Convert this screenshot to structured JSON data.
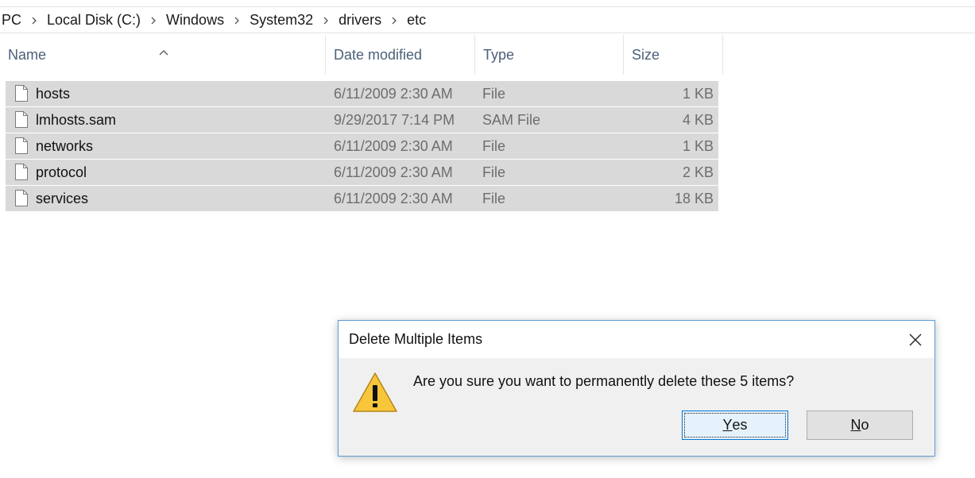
{
  "breadcrumb": [
    "PC",
    "Local Disk (C:)",
    "Windows",
    "System32",
    "drivers",
    "etc"
  ],
  "columns": {
    "name": "Name",
    "date_modified": "Date modified",
    "type": "Type",
    "size": "Size"
  },
  "files": [
    {
      "name": "hosts",
      "date": "6/11/2009 2:30 AM",
      "type": "File",
      "size": "1 KB"
    },
    {
      "name": "lmhosts.sam",
      "date": "9/29/2017 7:14 PM",
      "type": "SAM File",
      "size": "4 KB"
    },
    {
      "name": "networks",
      "date": "6/11/2009 2:30 AM",
      "type": "File",
      "size": "1 KB"
    },
    {
      "name": "protocol",
      "date": "6/11/2009 2:30 AM",
      "type": "File",
      "size": "2 KB"
    },
    {
      "name": "services",
      "date": "6/11/2009 2:30 AM",
      "type": "File",
      "size": "18 KB"
    }
  ],
  "dialog": {
    "title": "Delete Multiple Items",
    "message": "Are you sure you want to permanently delete these 5 items?",
    "yes_mnemonic": "Y",
    "yes_rest": "es",
    "no_mnemonic": "N",
    "no_rest": "o",
    "icon": "warning-icon"
  },
  "colors": {
    "selection": "#d9d9d9",
    "dialog_border": "#5b9bd5",
    "accent": "#0078d7"
  }
}
